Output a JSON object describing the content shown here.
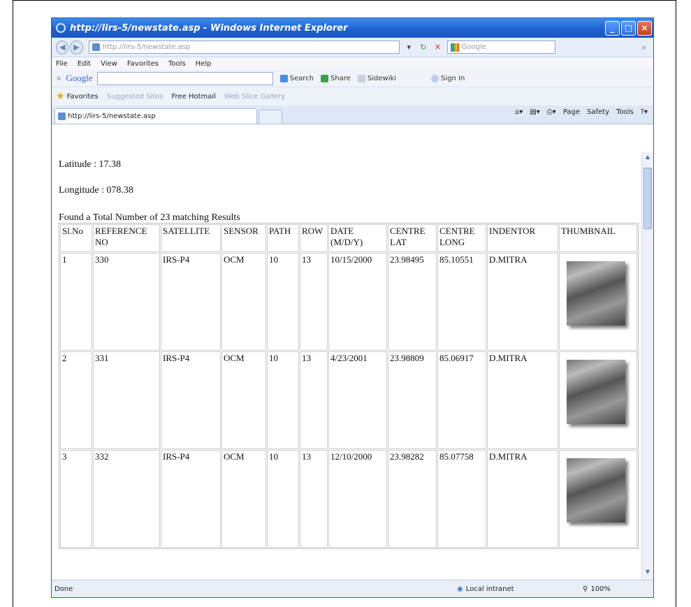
{
  "window": {
    "title": "http://lirs-5/newstate.asp - Windows Internet Explorer"
  },
  "nav": {
    "address": "http://lirs-5/newstate.asp",
    "search_placeholder": "Google"
  },
  "menu": [
    "File",
    "Edit",
    "View",
    "Favorites",
    "Tools",
    "Help"
  ],
  "google_bar": {
    "logo": "Google",
    "items": [
      "Search",
      "Share",
      "Sidewiki",
      "Sign In"
    ]
  },
  "favorites_bar": {
    "favorites": "Favorites",
    "suggested": "Suggested Sites",
    "hotmail": "Free Hotmail",
    "gallery": "Web Slice Gallery"
  },
  "tab": {
    "label": "http://lirs-5/newstate.asp"
  },
  "command_bar": [
    "Page",
    "Safety",
    "Tools"
  ],
  "page": {
    "latitude": "Latitude : 17.38",
    "longitude": "Longitude : 078.38",
    "found": "Found a Total Number of 23 matching Results"
  },
  "table": {
    "headers": [
      "Sl.No",
      "REFERENCE NO",
      "SATELLITE",
      "SENSOR",
      "PATH",
      "ROW",
      "DATE (M/D/Y)",
      "CENTRE LAT",
      "CENTRE LONG",
      "INDENTOR",
      "THUMBNAIL"
    ],
    "rows": [
      [
        "1",
        "330",
        "IRS-P4",
        "OCM",
        "10",
        "13",
        "10/15/2000",
        "23.98495",
        "85.10551",
        "D.MITRA"
      ],
      [
        "2",
        "331",
        "IRS-P4",
        "OCM",
        "10",
        "13",
        "4/23/2001",
        "23.98809",
        "85.06917",
        "D.MITRA"
      ],
      [
        "3",
        "332",
        "IRS-P4",
        "OCM",
        "10",
        "13",
        "12/10/2000",
        "23.98282",
        "85.07758",
        "D.MITRA"
      ]
    ]
  },
  "status": {
    "left": "Done",
    "zone": "Local intranet",
    "zoom": "100%"
  }
}
